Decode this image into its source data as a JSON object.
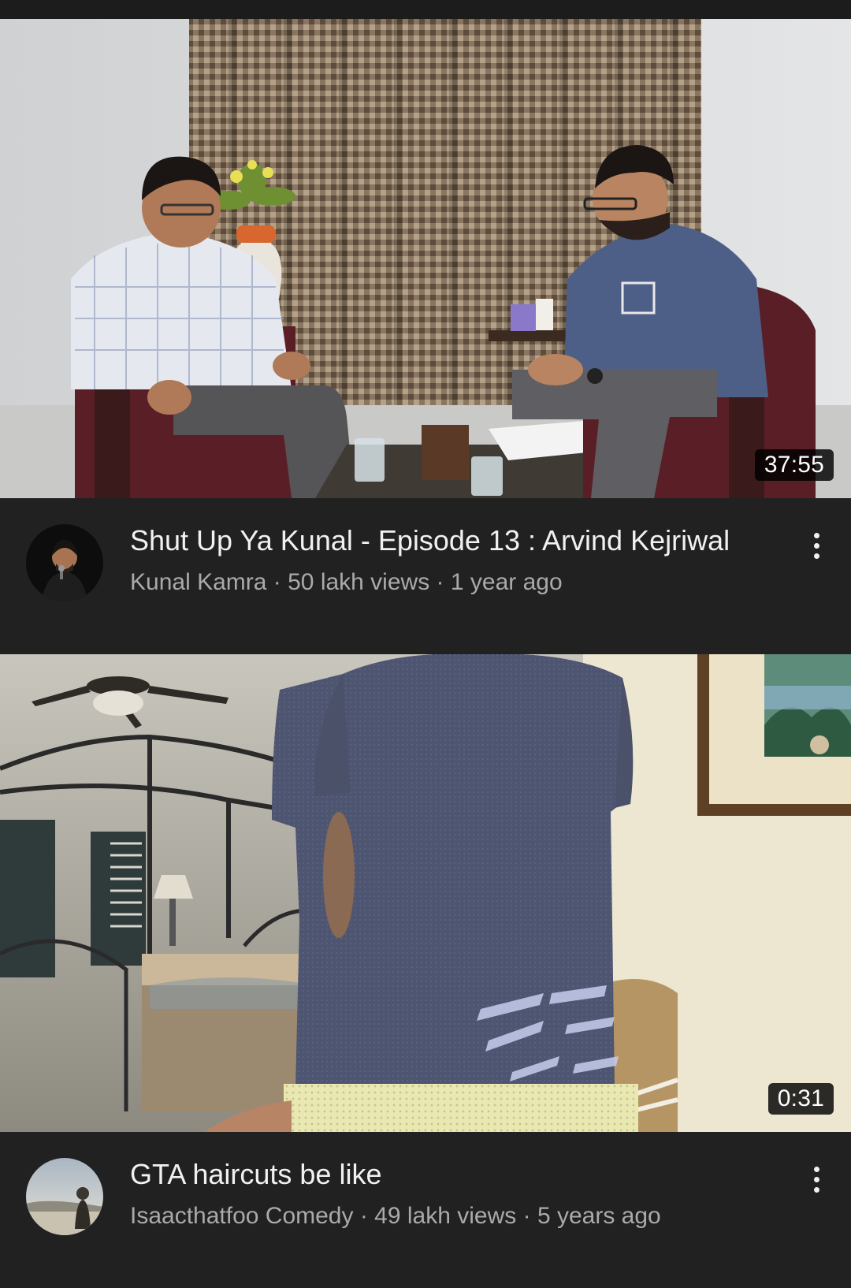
{
  "videos": [
    {
      "title": "Shut Up Ya Kunal - Episode 13 : Arvind Kejriwal",
      "channel": "Kunal Kamra",
      "views": "50 lakh views",
      "age": "1 year ago",
      "duration": "37:55"
    },
    {
      "title": "GTA haircuts be like",
      "channel": "Isaacthatfoo Comedy",
      "views": "49 lakh views",
      "age": "5 years ago",
      "duration": "0:31"
    }
  ],
  "separator": " · ",
  "icons": {
    "more": "more-vert-icon"
  },
  "colors": {
    "background": "#212121",
    "title": "#f1f1f1",
    "subtitle": "#aaaaaa"
  }
}
